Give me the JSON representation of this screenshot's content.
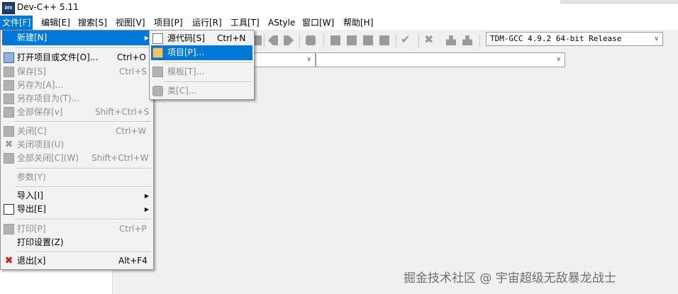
{
  "window": {
    "title": "Dev-C++ 5.11",
    "app_icon_text": "DEV"
  },
  "menubar": [
    {
      "label": "文件[F]"
    },
    {
      "label": "编辑[E]"
    },
    {
      "label": "搜索[S]"
    },
    {
      "label": "视图[V]"
    },
    {
      "label": "项目[P]"
    },
    {
      "label": "运行[R]"
    },
    {
      "label": "工具[T]"
    },
    {
      "label": "AStyle"
    },
    {
      "label": "窗口[W]"
    },
    {
      "label": "帮助[H]"
    }
  ],
  "toolbar": {
    "compiler": "TDM-GCC 4.9.2 64-bit Release"
  },
  "file_menu": {
    "items": {
      "new": {
        "label": "新建[N]"
      },
      "open": {
        "label": "打开项目或文件[O]...",
        "shortcut": "Ctrl+O"
      },
      "save": {
        "label": "保存[S]",
        "shortcut": "Ctrl+S"
      },
      "save_as": {
        "label": "另存为[A]..."
      },
      "save_project_as": {
        "label": "另存项目为(T)..."
      },
      "save_all": {
        "label": "全部保存[v]",
        "shortcut": "Shift+Ctrl+S"
      },
      "close": {
        "label": "关闭[C]",
        "shortcut": "Ctrl+W"
      },
      "close_project": {
        "label": "关闭项目(U)"
      },
      "close_all": {
        "label": "全部关闭[C](W)",
        "shortcut": "Shift+Ctrl+W"
      },
      "params": {
        "label": "参数(Y)"
      },
      "import": {
        "label": "导入[I]"
      },
      "export": {
        "label": "导出[E]"
      },
      "print": {
        "label": "打印[P]",
        "shortcut": "Ctrl+P"
      },
      "print_setup": {
        "label": "打印设置(Z)"
      },
      "exit": {
        "label": "退出[x]",
        "shortcut": "Alt+F4"
      }
    }
  },
  "new_submenu": {
    "source": {
      "label": "源代码[S]",
      "shortcut": "Ctrl+N"
    },
    "project": {
      "label": "项目[P]..."
    },
    "template": {
      "label": "模板[T]..."
    },
    "class": {
      "label": "类[C]..."
    }
  },
  "watermark": "掘金技术社区 @ 宇宙超级无敌暴龙战士"
}
